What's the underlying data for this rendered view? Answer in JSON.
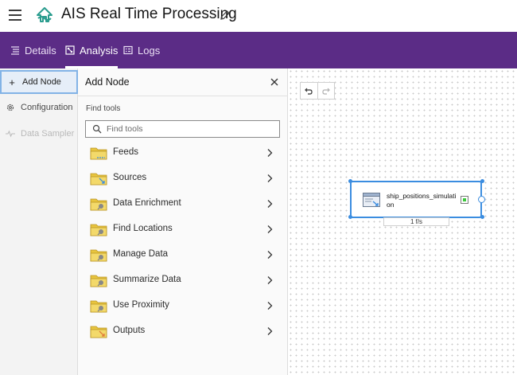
{
  "header": {
    "title": "AIS Real Time Processing",
    "menu_icon": "hamburger-menu-icon",
    "logo_icon": "velocity-logo-icon",
    "edit_icon": "pencil-edit-icon"
  },
  "tabs": [
    {
      "label": "Details",
      "icon": "details-icon",
      "active": false
    },
    {
      "label": "Analysis",
      "icon": "analysis-icon",
      "active": true
    },
    {
      "label": "Logs",
      "icon": "logs-icon",
      "active": false
    }
  ],
  "sidebar": {
    "items": [
      {
        "label": "Add Node",
        "icon": "plus-icon",
        "state": "active"
      },
      {
        "label": "Configuration",
        "icon": "gear-icon",
        "state": "normal"
      },
      {
        "label": "Data Sampler",
        "icon": "pulse-icon",
        "state": "disabled"
      }
    ]
  },
  "panel": {
    "title": "Add Node",
    "find_label": "Find tools",
    "search_placeholder": "Find tools",
    "tools": [
      {
        "label": "Feeds",
        "icon": "feeds-folder-icon"
      },
      {
        "label": "Sources",
        "icon": "sources-folder-icon"
      },
      {
        "label": "Data Enrichment",
        "icon": "data-enrichment-folder-icon"
      },
      {
        "label": "Find Locations",
        "icon": "find-locations-folder-icon"
      },
      {
        "label": "Manage Data",
        "icon": "manage-data-folder-icon"
      },
      {
        "label": "Summarize Data",
        "icon": "summarize-data-folder-icon"
      },
      {
        "label": "Use Proximity",
        "icon": "use-proximity-folder-icon"
      },
      {
        "label": "Outputs",
        "icon": "outputs-folder-icon"
      }
    ]
  },
  "canvas": {
    "node": {
      "label": "ship_positions_simulation",
      "rate": "1 f/s",
      "icon": "feed-table-icon"
    }
  },
  "colors": {
    "brand_purple": "#5b2c86",
    "accent_blue": "#3b8de0",
    "logo_teal": "#2a9c8e",
    "folder_yellow": "#e8c53e",
    "status_green": "#3cc83c"
  }
}
